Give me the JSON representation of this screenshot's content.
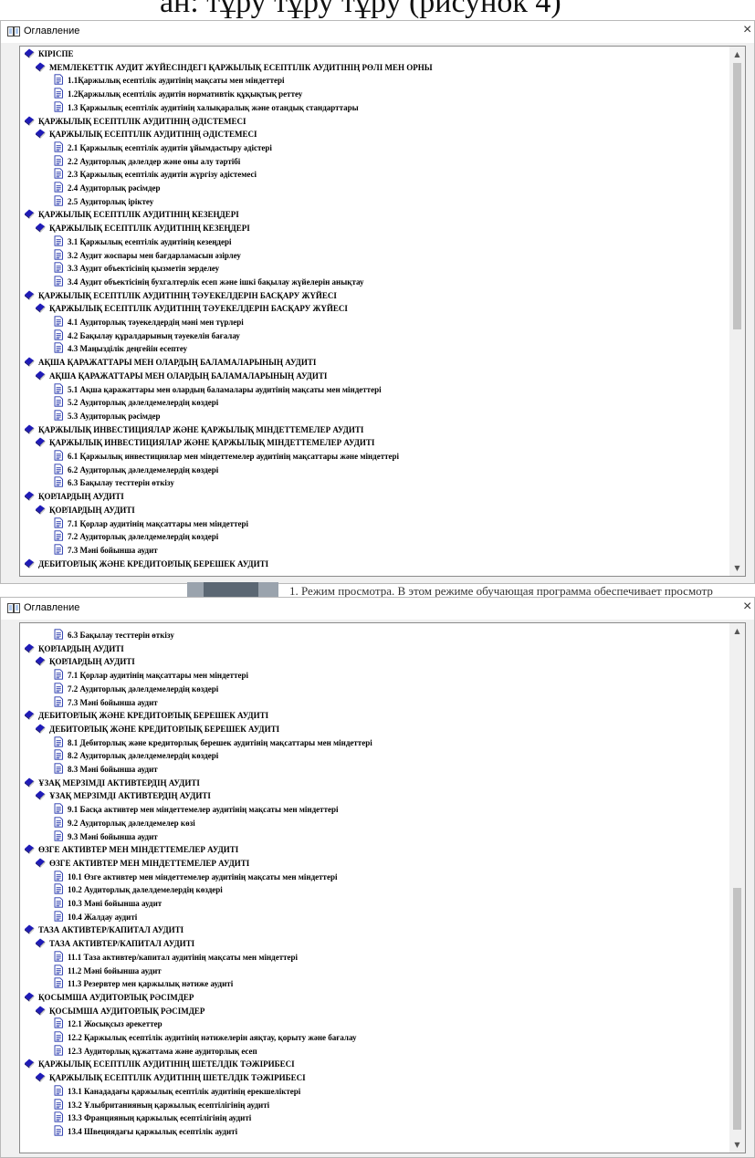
{
  "top_fragment": "ан: тұру тұру тұру (рисунок 4)",
  "bg_fragment": "1.  Режим просмотра. В этом режиме обучающая программа обеспечивает просмотр",
  "window_title": "Оглавление",
  "close_glyph": "×",
  "colors": {
    "book_icon": "#1f1bb8",
    "page_icon": "#2233aa",
    "thumb": "#c2c2c2"
  },
  "panel1": {
    "items": [
      {
        "level": 0,
        "icon": "book-icon",
        "text": "КІРІСПЕ"
      },
      {
        "level": 1,
        "icon": "book-icon",
        "text": "МЕМЛЕКЕТТІК АУДИТ ЖҮЙЕСІНДЕГІ ҚАРЖЫЛЫҚ ЕСЕПТІЛІК АУДИТІНІҢ РӨЛІ МЕН ОРНЫ"
      },
      {
        "level": 2,
        "icon": "page-icon",
        "text": "1.1Қаржылық есептілік аудитінің мақсаты мен міндеттері"
      },
      {
        "level": 2,
        "icon": "page-icon",
        "text": "1.2Қаржылық есептілік аудитін нормативтік құқықтық реттеу"
      },
      {
        "level": 2,
        "icon": "page-icon",
        "text": "1.3 Қаржылық есептілік аудитінің халықаралық және отандық стандарттары"
      },
      {
        "level": 0,
        "icon": "book-icon",
        "text": "ҚАРЖЫЛЫҚ ЕСЕПТІЛІК АУДИТІНІҢ ӘДІСТЕМЕСІ"
      },
      {
        "level": 1,
        "icon": "book-icon",
        "text": "ҚАРЖЫЛЫҚ ЕСЕПТІЛІК АУДИТІНІҢ ӘДІСТЕМЕСІ"
      },
      {
        "level": 2,
        "icon": "page-icon",
        "text": "2.1 Қаржылық есептілік аудитін ұйымдастыру әдістері"
      },
      {
        "level": 2,
        "icon": "page-icon",
        "text": "2.2 Аудиторлық дәлелдер және оны алу тәртібі"
      },
      {
        "level": 2,
        "icon": "page-icon",
        "text": "2.3 Қаржылық есептілік аудитін жүргізу әдістемесі"
      },
      {
        "level": 2,
        "icon": "page-icon",
        "text": "2.4 Аудиторлық рәсімдер"
      },
      {
        "level": 2,
        "icon": "page-icon",
        "text": "2.5 Аудиторлық іріктеу"
      },
      {
        "level": 0,
        "icon": "book-icon",
        "text": "ҚАРЖЫЛЫҚ ЕСЕПТІЛІК АУДИТІНІҢ КЕЗЕҢДЕРІ"
      },
      {
        "level": 1,
        "icon": "book-icon",
        "text": "ҚАРЖЫЛЫҚ ЕСЕПТІЛІК АУДИТІНІҢ КЕЗЕҢДЕРІ"
      },
      {
        "level": 2,
        "icon": "page-icon",
        "text": "3.1 Қаржылық есептілік аудитінің кезеңдері"
      },
      {
        "level": 2,
        "icon": "page-icon",
        "text": "3.2 Аудит жоспары мен бағдарламасын әзірлеу"
      },
      {
        "level": 2,
        "icon": "page-icon",
        "text": "3.3 Аудит объектісінің қызметін зерделеу"
      },
      {
        "level": 2,
        "icon": "page-icon",
        "text": "3.4 Аудит объектісінің бухгалтерлік есеп және ішкі бақылау жүйелерін анықтау"
      },
      {
        "level": 0,
        "icon": "book-icon",
        "text": "ҚАРЖЫЛЫҚ ЕСЕПТІЛІК АУДИТІНІҢ ТӘУЕКЕЛДЕРІН БАСҚАРУ ЖҮЙЕСІ"
      },
      {
        "level": 1,
        "icon": "book-icon",
        "text": "ҚАРЖЫЛЫҚ ЕСЕПТІЛІК АУДИТІНІҢ ТӘУЕКЕЛДЕРІН БАСҚАРУ ЖҮЙЕСІ"
      },
      {
        "level": 2,
        "icon": "page-icon",
        "text": "4.1 Аудиторлық тәуекелдердің мәні мен түрлері"
      },
      {
        "level": 2,
        "icon": "page-icon",
        "text": "4.2 Бақылау құралдарының тәуекелін бағалау"
      },
      {
        "level": 2,
        "icon": "page-icon",
        "text": "4.3 Маңызділік деңгейін есептеу"
      },
      {
        "level": 0,
        "icon": "book-icon",
        "text": "АҚША ҚАРАЖАТТАРЫ МЕН ОЛАРДЫҢ БАЛАМАЛАРЫНЫҢ АУДИТІ"
      },
      {
        "level": 1,
        "icon": "book-icon",
        "text": "АҚША ҚАРАЖАТТАРЫ МЕН ОЛАРДЫҢ БАЛАМАЛАРЫНЫҢ АУДИТІ"
      },
      {
        "level": 2,
        "icon": "page-icon",
        "text": "5.1 Ақша қаражаттары мен олардың баламалары аудитінің мақсаты мен міндеттері"
      },
      {
        "level": 2,
        "icon": "page-icon",
        "text": "5.2 Аудиторлық дәлелдемелердің көздері"
      },
      {
        "level": 2,
        "icon": "page-icon",
        "text": "5.3 Аудиторлық рәсімдер"
      },
      {
        "level": 0,
        "icon": "book-icon",
        "text": "ҚАРЖЫЛЫҚ ИНВЕСТИЦИЯЛАР ЖӘНЕ ҚАРЖЫЛЫҚ МІНДЕТТЕМЕЛЕР АУДИТІ"
      },
      {
        "level": 1,
        "icon": "book-icon",
        "text": "ҚАРЖЫЛЫҚ ИНВЕСТИЦИЯЛАР ЖӘНЕ ҚАРЖЫЛЫҚ МІНДЕТТЕМЕЛЕР АУДИТІ"
      },
      {
        "level": 2,
        "icon": "page-icon",
        "text": "6.1 Қаржылық инвестициялар мен міндеттемелер аудитінің мақсаттары және міндеттері"
      },
      {
        "level": 2,
        "icon": "page-icon",
        "text": "6.2 Аудиторлық дәлелдемелердің көздері"
      },
      {
        "level": 2,
        "icon": "page-icon",
        "text": "6.3 Бақылау тесттерін өткізу"
      },
      {
        "level": 0,
        "icon": "book-icon",
        "text": "ҚОРЛАРДЫҢ АУДИТІ"
      },
      {
        "level": 1,
        "icon": "book-icon",
        "text": "ҚОРЛАРДЫҢ АУДИТІ"
      },
      {
        "level": 2,
        "icon": "page-icon",
        "text": "7.1 Қорлар аудитінің мақсаттары мен міндеттері"
      },
      {
        "level": 2,
        "icon": "page-icon",
        "text": "7.2 Аудиторлық дәлелдемелердің көздері"
      },
      {
        "level": 2,
        "icon": "page-icon",
        "text": "7.3 Мәні бойынша аудит"
      },
      {
        "level": 0,
        "icon": "book-icon",
        "text": "ДЕБИТОРЛЫҚ ЖӘНЕ КРЕДИТОРЛЫҚ БЕРЕШЕК АУДИТІ"
      }
    ]
  },
  "panel2": {
    "items": [
      {
        "level": 2,
        "icon": "page-icon",
        "text": "6.3 Бақылау тесттерін өткізу"
      },
      {
        "level": 0,
        "icon": "book-icon",
        "text": "ҚОРЛАРДЫҢ АУДИТІ"
      },
      {
        "level": 1,
        "icon": "book-icon",
        "text": "ҚОРЛАРДЫҢ АУДИТІ"
      },
      {
        "level": 2,
        "icon": "page-icon",
        "text": "7.1 Қорлар аудитінің мақсаттары мен міндеттері"
      },
      {
        "level": 2,
        "icon": "page-icon",
        "text": "7.2 Аудиторлық дәлелдемелердің көздері"
      },
      {
        "level": 2,
        "icon": "page-icon",
        "text": "7.3 Мәні бойынша аудит"
      },
      {
        "level": 0,
        "icon": "book-icon",
        "text": "ДЕБИТОРЛЫҚ ЖӘНЕ КРЕДИТОРЛЫҚ БЕРЕШЕК АУДИТІ"
      },
      {
        "level": 1,
        "icon": "book-icon",
        "text": "ДЕБИТОРЛЫҚ ЖӘНЕ КРЕДИТОРЛЫҚ БЕРЕШЕК АУДИТІ"
      },
      {
        "level": 2,
        "icon": "page-icon",
        "text": "8.1 Дебиторлық және кредиторлық берешек аудитінің мақсаттары мен міндеттері"
      },
      {
        "level": 2,
        "icon": "page-icon",
        "text": "8.2 Аудиторлық дәлелдемелердің көздері"
      },
      {
        "level": 2,
        "icon": "page-icon",
        "text": "8.3 Мәні бойынша аудит"
      },
      {
        "level": 0,
        "icon": "book-icon",
        "text": "ҰЗАҚ МЕРЗІМДІ АКТИВТЕРДІҢ АУДИТІ"
      },
      {
        "level": 1,
        "icon": "book-icon",
        "text": "ҰЗАҚ МЕРЗІМДІ АКТИВТЕРДІҢ АУДИТІ"
      },
      {
        "level": 2,
        "icon": "page-icon",
        "text": "9.1 Басқа активтер мен міндеттемелер аудитінің мақсаты мен міндеттері"
      },
      {
        "level": 2,
        "icon": "page-icon",
        "text": "9.2 Аудиторлық дәлелдемелер көзі"
      },
      {
        "level": 2,
        "icon": "page-icon",
        "text": "9.3 Мәні бойынша аудит"
      },
      {
        "level": 0,
        "icon": "book-icon",
        "text": "ӨЗГЕ АКТИВТЕР МЕН МІНДЕТТЕМЕЛЕР АУДИТІ"
      },
      {
        "level": 1,
        "icon": "book-icon",
        "text": "ӨЗГЕ АКТИВТЕР МЕН МІНДЕТТЕМЕЛЕР АУДИТІ"
      },
      {
        "level": 2,
        "icon": "page-icon",
        "text": "10.1 Өзге активтер мен міндеттемелер аудитінің мақсаты мен міндеттері"
      },
      {
        "level": 2,
        "icon": "page-icon",
        "text": "10.2 Аудиторлық дәлелдемелердің көздері"
      },
      {
        "level": 2,
        "icon": "page-icon",
        "text": "10.3 Мәні бойынша аудит"
      },
      {
        "level": 2,
        "icon": "page-icon",
        "text": "10.4 Жалдау аудиті"
      },
      {
        "level": 0,
        "icon": "book-icon",
        "text": "ТАЗА АКТИВТЕР/КАПИТАЛ АУДИТІ"
      },
      {
        "level": 1,
        "icon": "book-icon",
        "text": "ТАЗА АКТИВТЕР/КАПИТАЛ АУДИТІ"
      },
      {
        "level": 2,
        "icon": "page-icon",
        "text": "11.1 Таза активтер/капитал аудитінің мақсаты мен міндеттері"
      },
      {
        "level": 2,
        "icon": "page-icon",
        "text": "11.2 Мәні бойынша аудит"
      },
      {
        "level": 2,
        "icon": "page-icon",
        "text": "11.3 Резервтер мен қаржылық нәтиже аудиті"
      },
      {
        "level": 0,
        "icon": "book-icon",
        "text": "ҚОСЫМША АУДИТОРЛЫҚ РӘСІМДЕР"
      },
      {
        "level": 1,
        "icon": "book-icon",
        "text": "ҚОСЫМША АУДИТОРЛЫҚ РӘСІМДЕР"
      },
      {
        "level": 2,
        "icon": "page-icon",
        "text": "12.1 Жосықсыз әрекеттер"
      },
      {
        "level": 2,
        "icon": "page-icon",
        "text": "12.2 Қаржылық есептілік аудитінің нәтижелерін аяқтау, қорыту және бағалау"
      },
      {
        "level": 2,
        "icon": "page-icon",
        "text": "12.3 Аудиторлық құжаттама және аудиторлық есеп"
      },
      {
        "level": 0,
        "icon": "book-icon",
        "text": "ҚАРЖЫЛЫҚ ЕСЕПТІЛІК АУДИТІНІҢ ШЕТЕЛДІК ТӘЖІРИБЕСІ"
      },
      {
        "level": 1,
        "icon": "book-icon",
        "text": "ҚАРЖЫЛЫҚ ЕСЕПТІЛІК АУДИТІНІҢ ШЕТЕЛДІК ТӘЖІРИБЕСІ"
      },
      {
        "level": 2,
        "icon": "page-icon",
        "text": "13.1 Канададағы қаржылық есептілік аудитінің ерекшеліктері"
      },
      {
        "level": 2,
        "icon": "page-icon",
        "text": "13.2 Ұлыбританияның қаржылық есептілігінің аудиті"
      },
      {
        "level": 2,
        "icon": "page-icon",
        "text": "13.3 Францияның қаржылық есептілігінің аудиті"
      },
      {
        "level": 2,
        "icon": "page-icon",
        "text": "13.4 Швециядағы қаржылық есептілік аудиті"
      }
    ]
  }
}
